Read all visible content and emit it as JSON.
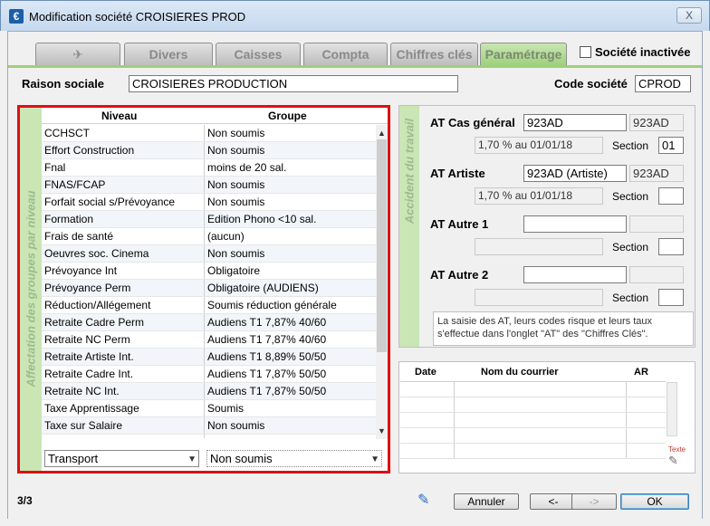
{
  "window": {
    "title": "Modification société CROISIERES PROD",
    "close": "X"
  },
  "tabs": [
    {
      "label": "✈"
    },
    {
      "label": "Divers"
    },
    {
      "label": "Caisses"
    },
    {
      "label": "Compta"
    },
    {
      "label": "Chiffres clés"
    },
    {
      "label": "Paramétrage",
      "active": true
    }
  ],
  "inactive_label": "Société inactivée",
  "raison": {
    "label": "Raison sociale",
    "value": "CROISIERES PRODUCTION"
  },
  "code": {
    "label": "Code société",
    "value": "CPROD"
  },
  "affectation": {
    "vertical_label": "Affectation des groupes par niveau",
    "headers": {
      "niveau": "Niveau",
      "groupe": "Groupe"
    },
    "rows": [
      {
        "niveau": "CCHSCT",
        "groupe": "Non soumis"
      },
      {
        "niveau": "Effort Construction",
        "groupe": "Non soumis"
      },
      {
        "niveau": "Fnal",
        "groupe": "moins de 20 sal."
      },
      {
        "niveau": "FNAS/FCAP",
        "groupe": "Non soumis"
      },
      {
        "niveau": "Forfait social s/Prévoyance",
        "groupe": "Non soumis"
      },
      {
        "niveau": "Formation",
        "groupe": "Edition Phono <10 sal."
      },
      {
        "niveau": "Frais de santé",
        "groupe": "(aucun)"
      },
      {
        "niveau": "Oeuvres soc. Cinema",
        "groupe": "Non soumis"
      },
      {
        "niveau": "Prévoyance Int",
        "groupe": "Obligatoire"
      },
      {
        "niveau": "Prévoyance Perm",
        "groupe": "Obligatoire (AUDIENS)"
      },
      {
        "niveau": "Réduction/Allégement",
        "groupe": "Soumis réduction générale"
      },
      {
        "niveau": "Retraite  Cadre Perm",
        "groupe": "Audiens T1 7,87% 40/60"
      },
      {
        "niveau": "Retraite  NC Perm",
        "groupe": "Audiens T1 7,87% 40/60"
      },
      {
        "niveau": "Retraite Artiste Int.",
        "groupe": "Audiens T1 8,89% 50/50"
      },
      {
        "niveau": "Retraite Cadre Int.",
        "groupe": "Audiens T1 7,87% 50/50"
      },
      {
        "niveau": "Retraite NC Int.",
        "groupe": "Audiens T1 7,87% 50/50"
      },
      {
        "niveau": "Taxe Apprentissage",
        "groupe": "Soumis"
      },
      {
        "niveau": "Taxe sur Salaire",
        "groupe": "Non soumis"
      },
      {
        "niveau": "Transport",
        "groupe": ""
      }
    ],
    "combo_niveau": "Transport",
    "combo_groupe": "Non soumis"
  },
  "accident": {
    "vertical_label": "Accident du travail",
    "section_label": "Section",
    "general": {
      "label": "AT Cas général",
      "code": "923AD",
      "code2": "923AD",
      "rate": "1,70 % au 01/01/18",
      "section": "01"
    },
    "artiste": {
      "label": "AT Artiste",
      "code": "923AD (Artiste)",
      "code2": "923AD",
      "rate": "1,70 % au 01/01/18",
      "section": ""
    },
    "autre1": {
      "label": "AT Autre 1",
      "code": "",
      "code2": "",
      "rate": "",
      "section": ""
    },
    "autre2": {
      "label": "AT Autre 2",
      "code": "",
      "code2": "",
      "rate": "",
      "section": ""
    },
    "info": "La saisie des AT, leurs codes risque et leurs taux s'effectue dans l'onglet \"AT\" des \"Chiffres Clés\"."
  },
  "courrier": {
    "headers": {
      "date": "Date",
      "nom": "Nom du courrier",
      "ar": "AR"
    },
    "texte_label": "Texte"
  },
  "bottom": {
    "pager": "3/3",
    "annuler": "Annuler",
    "prev": "<-",
    "next": "->",
    "ok": "OK"
  }
}
